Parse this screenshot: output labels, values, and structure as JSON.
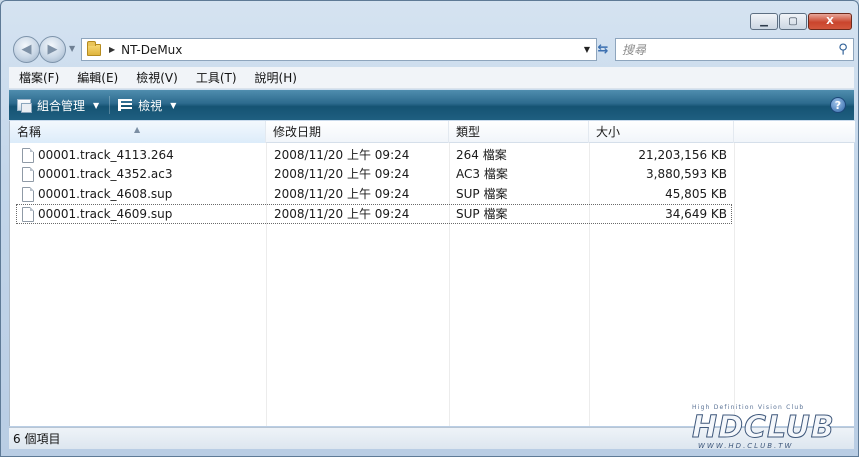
{
  "window": {
    "caption_buttons": {
      "minimize": "▁",
      "maximize": "▢",
      "close": "X"
    }
  },
  "nav": {
    "back_icon": "◀",
    "forward_icon": "▶",
    "history_dd": "▼",
    "address_arrow": "▶",
    "address_path": "NT-DeMux",
    "address_dd": "▼",
    "refresh_icon": "⇆",
    "search_placeholder": "搜尋",
    "search_icon_glyph": "⚲"
  },
  "menu": [
    {
      "label": "檔案(F)"
    },
    {
      "label": "編輯(E)"
    },
    {
      "label": "檢視(V)"
    },
    {
      "label": "工具(T)"
    },
    {
      "label": "說明(H)"
    }
  ],
  "commands": {
    "organize_label": "組合管理",
    "view_label": "檢視",
    "dd": "▼",
    "help_icon_glyph": "?"
  },
  "columns": {
    "name": "名稱",
    "date": "修改日期",
    "type": "類型",
    "size": "大小",
    "sort_glyph": "▲"
  },
  "files": [
    {
      "name": "00001.track_4113.264",
      "date": "2008/11/20 上午 09:24",
      "type": "264 檔案",
      "size": "21,203,156 KB"
    },
    {
      "name": "00001.track_4352.ac3",
      "date": "2008/11/20 上午 09:24",
      "type": "AC3 檔案",
      "size": "3,880,593 KB"
    },
    {
      "name": "00001.track_4608.sup",
      "date": "2008/11/20 上午 09:24",
      "type": "SUP 檔案",
      "size": "45,805 KB"
    },
    {
      "name": "00001.track_4609.sup",
      "date": "2008/11/20 上午 09:24",
      "type": "SUP 檔案",
      "size": "34,649 KB"
    }
  ],
  "status": {
    "item_count": "6 個項目"
  },
  "watermark": {
    "tagline": "High Definition Vision Club",
    "logo": "HDCLUB",
    "url": "WWW.HD.CLUB.TW"
  }
}
